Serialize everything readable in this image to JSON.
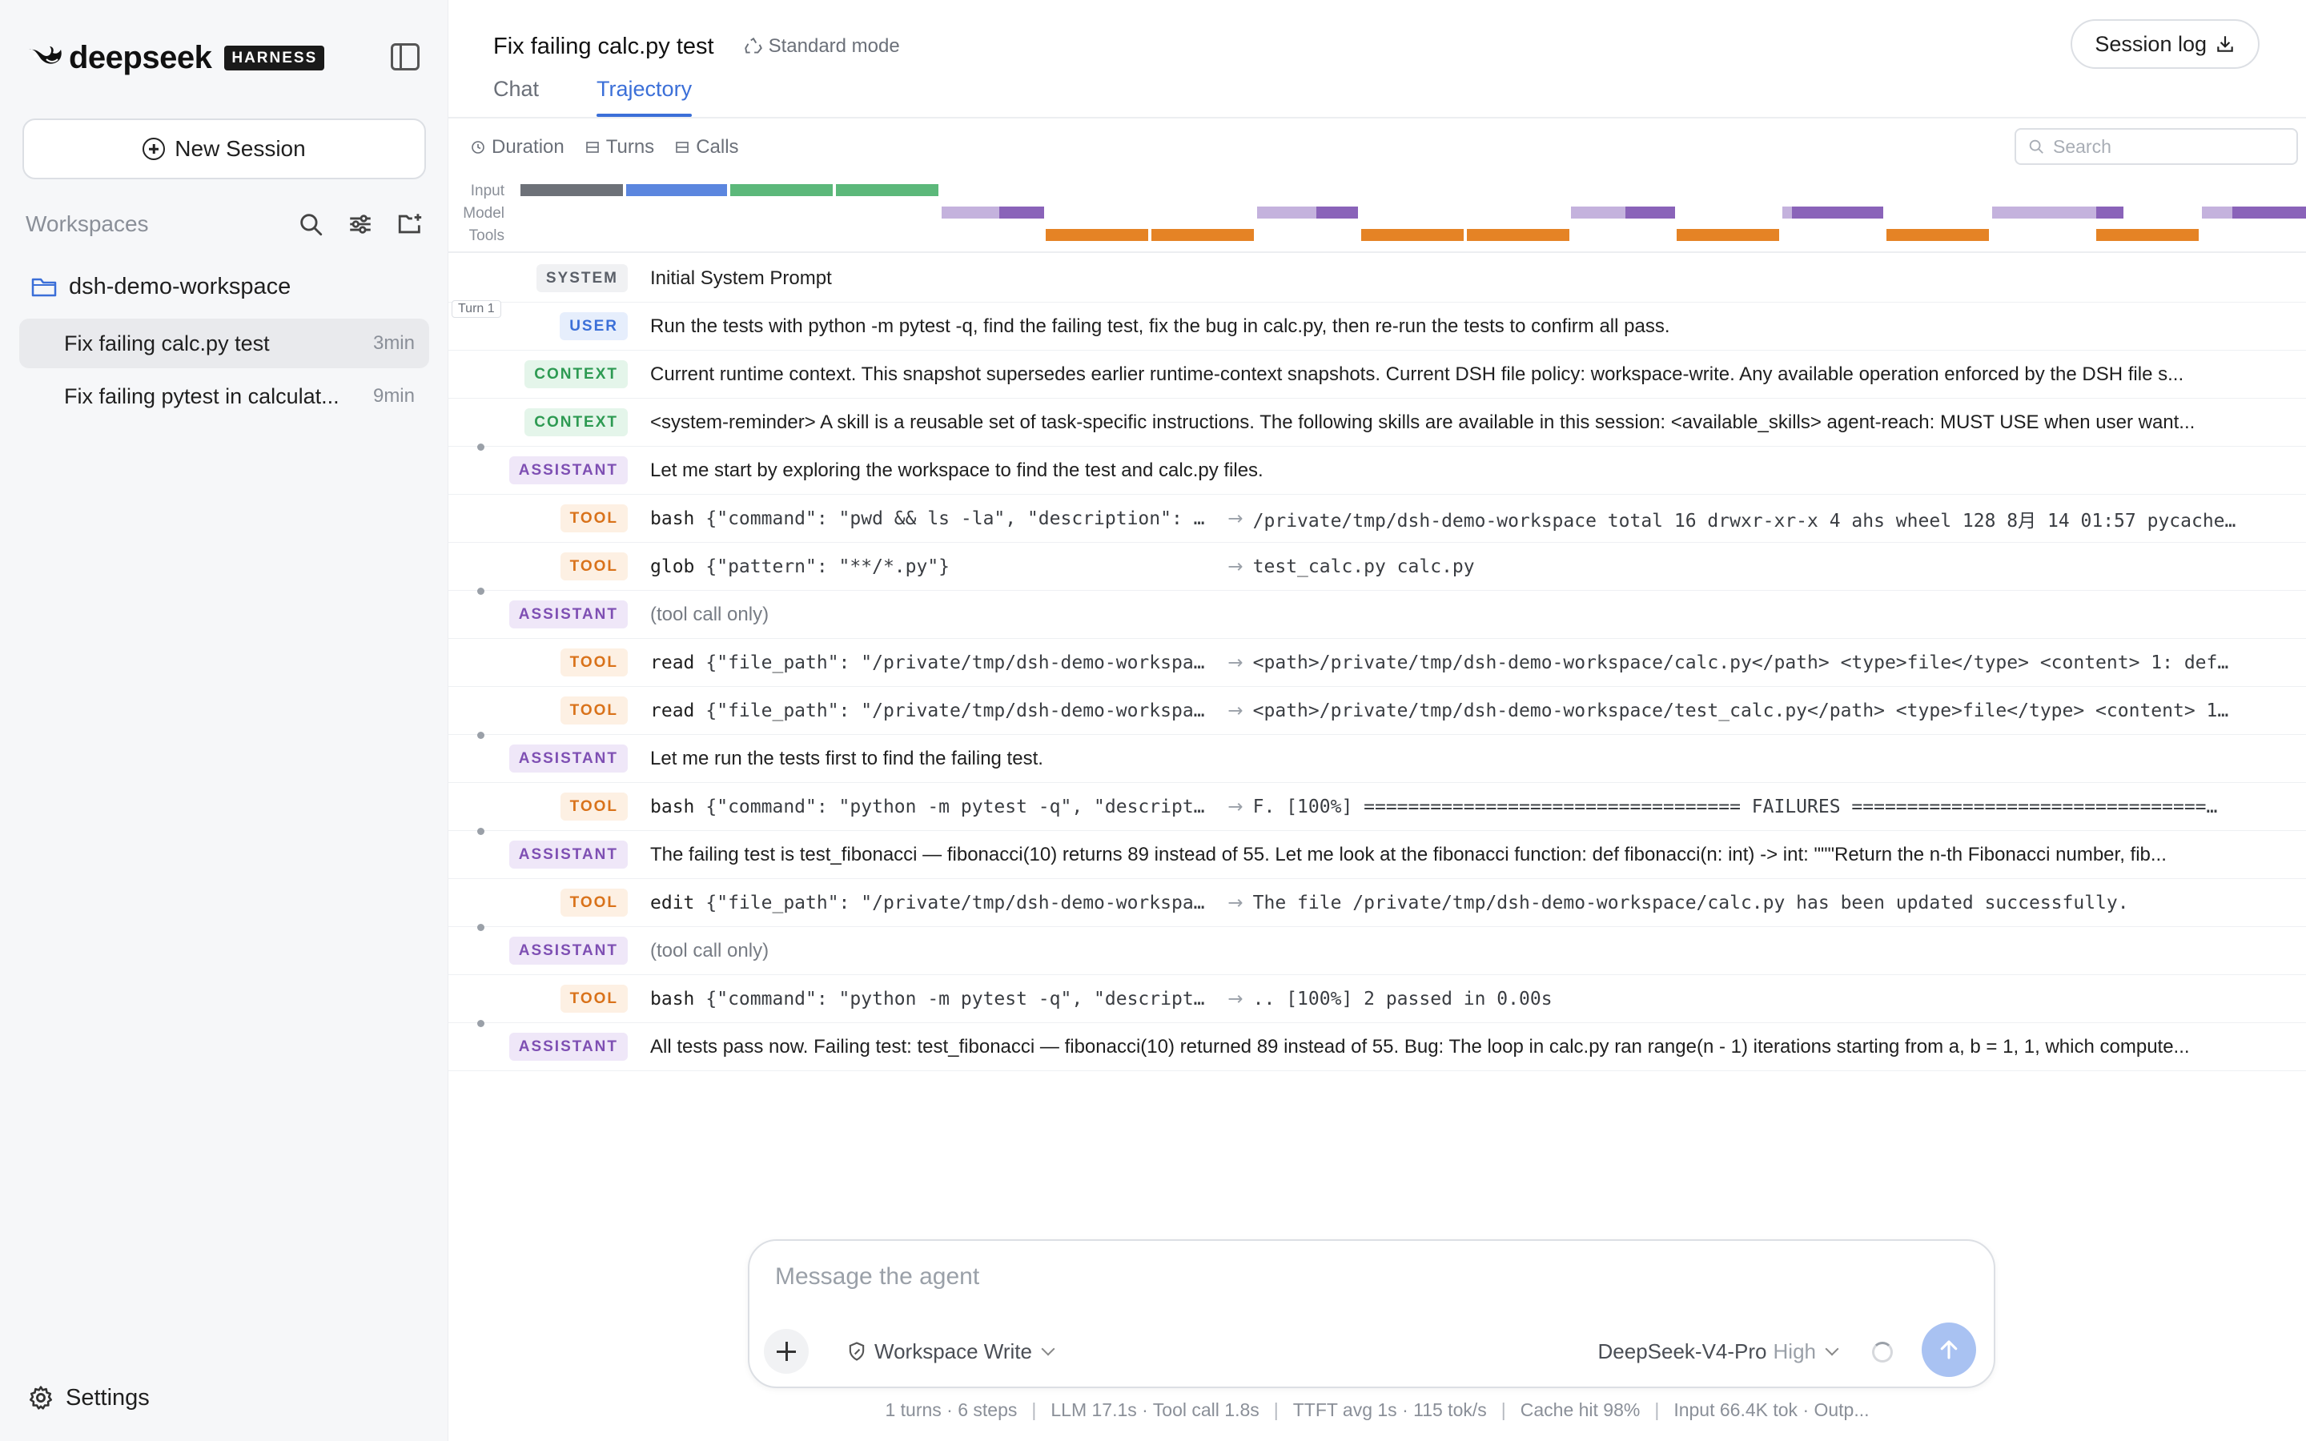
{
  "sidebar": {
    "brand_name": "deepseek",
    "brand_badge": "HARNESS",
    "new_session_label": "New Session",
    "workspaces_title": "Workspaces",
    "workspace_name": "dsh-demo-workspace",
    "sessions": [
      {
        "title": "Fix failing calc.py test",
        "time": "3min",
        "active": true
      },
      {
        "title": "Fix failing pytest in calculat...",
        "time": "9min",
        "active": false
      }
    ],
    "settings_label": "Settings"
  },
  "header": {
    "title": "Fix failing calc.py test",
    "mode": "Standard mode",
    "session_log_label": "Session log",
    "tabs": [
      {
        "label": "Chat",
        "active": false
      },
      {
        "label": "Trajectory",
        "active": true
      }
    ]
  },
  "toolbar": {
    "duration_label": "Duration",
    "turns_label": "Turns",
    "calls_label": "Calls",
    "search_placeholder": "Search"
  },
  "timeline": {
    "labels": [
      "Input",
      "Model",
      "Tools"
    ]
  },
  "turn_tag": "Turn 1",
  "rows": [
    {
      "role": "SYSTEM",
      "text": "Initial System Prompt"
    },
    {
      "role": "USER",
      "text": "Run the tests with python -m pytest -q, find the failing test, fix the bug in calc.py, then re-run the tests to confirm all pass."
    },
    {
      "role": "CONTEXT",
      "text": "Current runtime context. This snapshot supersedes earlier runtime-context snapshots. Current DSH file policy: workspace-write. Any available operation enforced by the DSH file s..."
    },
    {
      "role": "CONTEXT",
      "text": "<system-reminder> A skill is a reusable set of task-specific instructions. The following skills are available in this session: <available_skills> agent-reach: MUST USE when user want..."
    },
    {
      "role": "ASSISTANT",
      "text": "Let me start by exploring the workspace to find the test and calc.py files."
    },
    {
      "role": "TOOL",
      "name": "bash",
      "args": "{\"command\": \"pwd && ls -la\", \"description\": …",
      "result": "/private/tmp/dsh-demo-workspace total 16 drwxr-xr-x 4 ahs wheel 128 8月 14 01:57 pycache…"
    },
    {
      "role": "TOOL",
      "name": "glob",
      "args": "{\"pattern\": \"**/*.py\"}",
      "result": "test_calc.py calc.py"
    },
    {
      "role": "ASSISTANT",
      "text": "(tool call only)",
      "muted": true
    },
    {
      "role": "TOOL",
      "name": "read",
      "args": "{\"file_path\": \"/private/tmp/dsh-demo-workspa…",
      "result": "<path>/private/tmp/dsh-demo-workspace/calc.py</path> <type>file</type> <content> 1: def…"
    },
    {
      "role": "TOOL",
      "name": "read",
      "args": "{\"file_path\": \"/private/tmp/dsh-demo-workspa…",
      "result": "<path>/private/tmp/dsh-demo-workspace/test_calc.py</path> <type>file</type> <content> 1…"
    },
    {
      "role": "ASSISTANT",
      "text": "Let me run the tests first to find the failing test."
    },
    {
      "role": "TOOL",
      "name": "bash",
      "args": "{\"command\": \"python -m pytest -q\", \"descript…",
      "result": "F. [100%] ================================== FAILURES ================================…"
    },
    {
      "role": "ASSISTANT",
      "text": "The failing test is test_fibonacci — fibonacci(10) returns 89 instead of 55. Let me look at the fibonacci function: def fibonacci(n: int) -> int: \"\"\"Return the n-th Fibonacci number, fib..."
    },
    {
      "role": "TOOL",
      "name": "edit",
      "args": "{\"file_path\": \"/private/tmp/dsh-demo-workspa…",
      "result": "The file /private/tmp/dsh-demo-workspace/calc.py has been updated successfully."
    },
    {
      "role": "ASSISTANT",
      "text": "(tool call only)",
      "muted": true
    },
    {
      "role": "TOOL",
      "name": "bash",
      "args": "{\"command\": \"python -m pytest -q\", \"descript…",
      "result": ".. [100%] 2 passed in 0.00s"
    },
    {
      "role": "ASSISTANT",
      "text": "All tests pass now. Failing test: test_fibonacci — fibonacci(10) returned 89 instead of 55. Bug: The loop in calc.py ran range(n - 1) iterations starting from a, b = 1, 1, which compute..."
    }
  ],
  "composer": {
    "placeholder": "Message the agent",
    "permission_label": "Workspace Write",
    "model_name": "DeepSeek-V4-Pro",
    "model_level": "High"
  },
  "status": {
    "turns_steps": "1 turns · 6 steps",
    "llm_tool": "LLM 17.1s · Tool call 1.8s",
    "ttft": "TTFT avg 1s · 115 tok/s",
    "cache": "Cache hit 98%",
    "tokens": "Input 66.4K tok · Outp..."
  },
  "colors": {
    "accent": "#3b6fd8",
    "system": "#5a5f68",
    "user": "#3b6fd8",
    "context": "#2d9a52",
    "assistant": "#7e4fb3",
    "tool": "#d9721a"
  }
}
